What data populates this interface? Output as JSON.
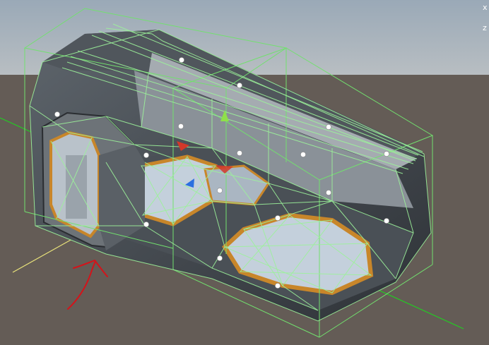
{
  "viewport": {
    "sky_color": "#97a6b4",
    "horizon_color": "#b6bcc1",
    "ground_color": "#645c56"
  },
  "gizmo": {
    "x_label": "x",
    "z_label": "z"
  },
  "colors": {
    "wireframe": "#9cf29a",
    "bounds_box": "#72e06e",
    "x_axis_line": "#22cc22",
    "z_axis_line": "#e8e27a",
    "hull_dark": "#3c3f44",
    "hull_mid": "#6d7378",
    "floor_panel": "#c4d0dc",
    "trim_orange": "#c8862a",
    "annotation_red": "#d4131a",
    "handle_green": "#8fe04a",
    "handle_red": "#d3382a",
    "handle_blue": "#2c6fe0"
  },
  "annotation": {
    "type": "hand-drawn-arrow",
    "color": "#d4131a",
    "points_to": "doorway"
  },
  "light_probes": 16
}
